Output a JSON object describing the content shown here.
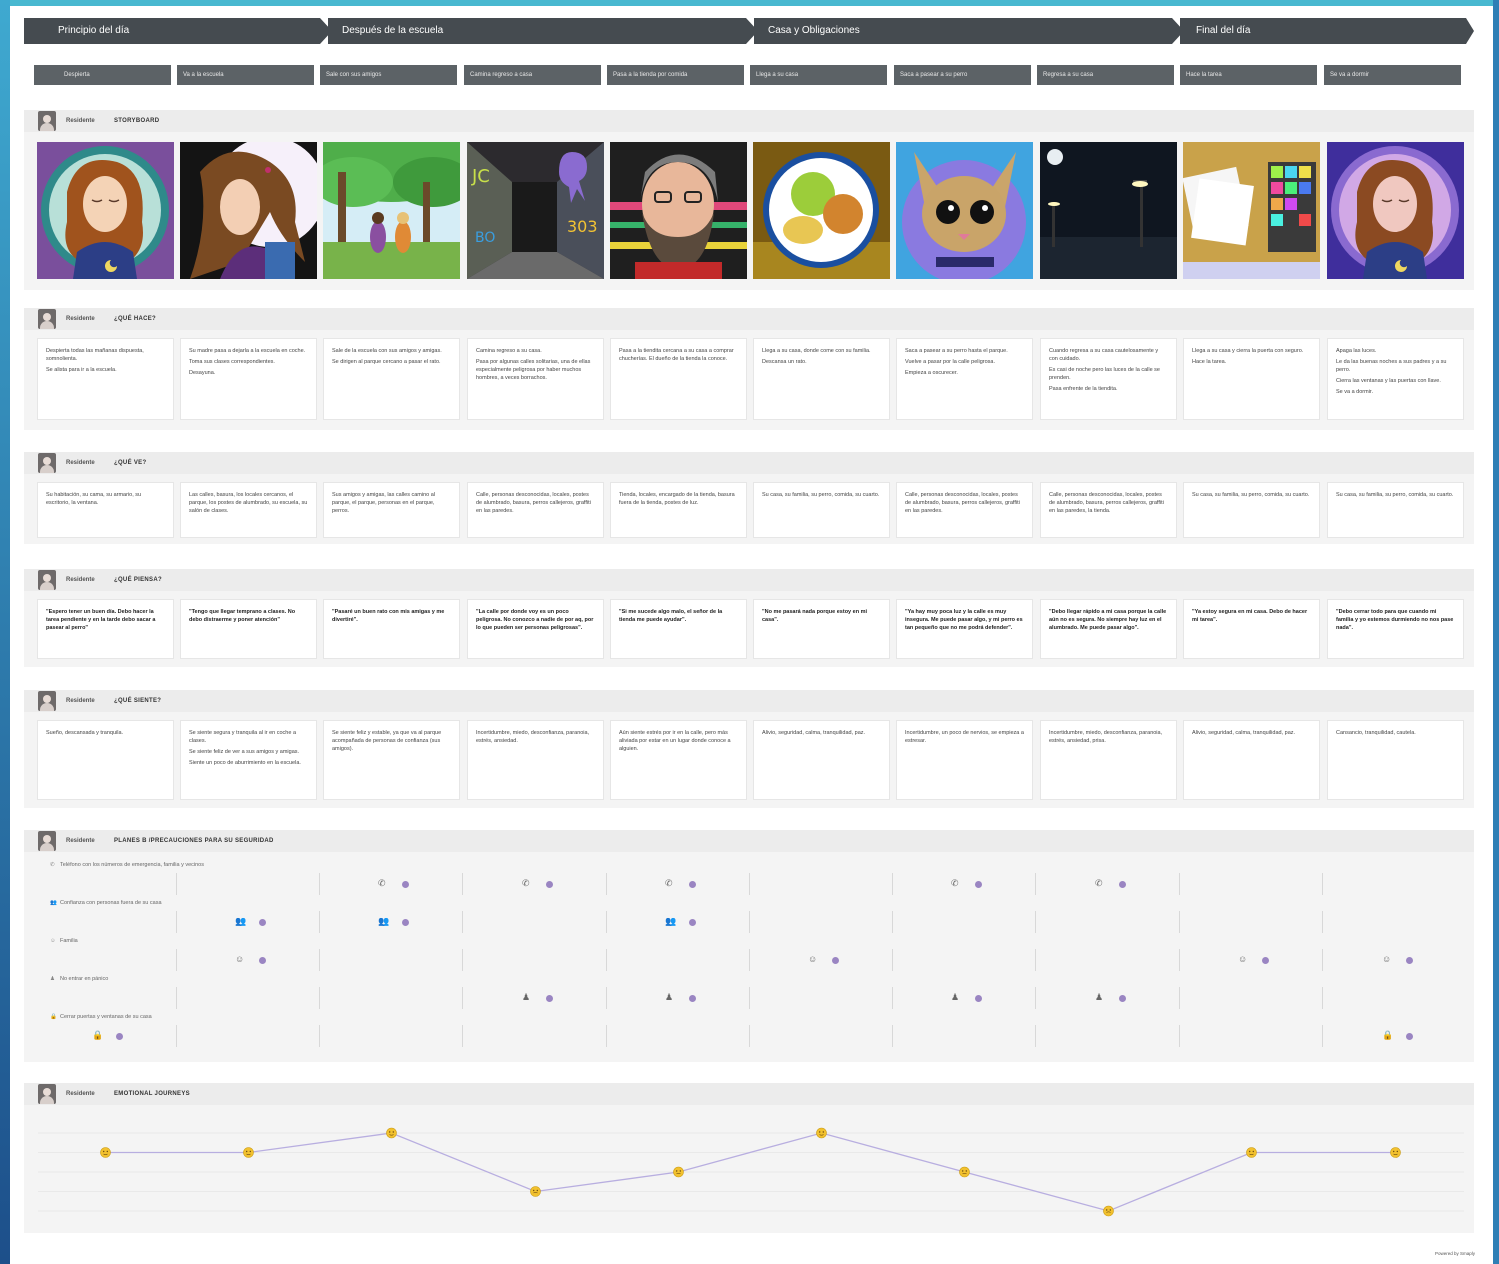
{
  "phases": [
    {
      "label": "Principio del día"
    },
    {
      "label": "Después de la escuela"
    },
    {
      "label": "Casa y Obligaciones"
    },
    {
      "label": "Final del día"
    }
  ],
  "steps": [
    "Despierta",
    "Va a la escuela",
    "Sale con sus amigos",
    "Camina regreso a casa",
    "Pasa a la tienda por comida",
    "Llega a su casa",
    "Saca a pasear a su perro",
    "Regresa a su casa",
    "Hace la tarea",
    "Se va a dormir"
  ],
  "persona": "Residente",
  "sections": {
    "storyboard": "STORYBOARD",
    "hace": "¿QUÉ HACE?",
    "ve": "¿QUÉ VE?",
    "piensa": "¿QUÉ PIENSA?",
    "siente": "¿QUÉ SIENTE?",
    "planes": "PLANES B /PRECAUCIONES PARA SU SEGURIDAD",
    "journey": "EMOTIONAL JOURNEYS"
  },
  "storyboard_images": [
    "girl-sleeping-image",
    "girl-backpack-image",
    "friends-park-image",
    "graffiti-alley-image",
    "shopkeeper-image",
    "dinner-plate-image",
    "dog-image",
    "night-street-image",
    "homework-board-image",
    "girl-sleeping-image"
  ],
  "hace": [
    [
      "Despierta todas las mañanas dispuesta, somnolienta.",
      "Se alista para ir a la escuela."
    ],
    [
      "Su madre pasa a dejarla a la escuela en coche.",
      "Toma sus clases correspondientes.",
      "Desayuna."
    ],
    [
      "Sale de la escuela con sus amigos y amigas.",
      "Se dirigen al parque cercano a pasar el rato."
    ],
    [
      "Camina regreso a su casa.",
      "Pasa por algunas calles solitarias, una de ellas especialmente peligrosa por haber muchos hombres, a veces borrachos."
    ],
    [
      "Pasa a la tiendita cercana a su casa a comprar chucherías. El dueño de la tienda la conoce."
    ],
    [
      "Llega a su casa, donde come con su familia.",
      "Descansa un rato."
    ],
    [
      "Saca a pasear a su perro hasta el parque.",
      "Vuelve a pasar por la calle peligrosa.",
      "Empieza a oscurecer."
    ],
    [
      "Cuando regresa a su casa cautelosamente y con cuidado.",
      "Es casi de noche pero las luces de la calle se prenden.",
      "Pasa enfrente de la tiendita."
    ],
    [
      "Llega a su casa y cierra la puerta con seguro.",
      "Hace la tarea."
    ],
    [
      "Apaga las luces.",
      "Le da las buenas noches a sus padres y a su perro.",
      "Cierra las ventanas y las puertas con llave.",
      "Se va a dormir."
    ]
  ],
  "ve": [
    "Su habitación, su cama, su armario, su escritorio, la ventana.",
    "Las calles, basura, los locales cercanos, el parque, los postes de alumbrado, su escuela, su salón de clases.",
    "Sus amigos y amigas, las calles camino al parque, el parque, personas en el parque, perros.",
    "Calle, personas desconocidas, locales, postes de alumbrado, basura, perros callejeros, graffiti en las paredes.",
    "Tienda, locales, encargado de la tienda, basura fuera de la tienda, postes de luz.",
    "Su casa, su familia, su perro, comida, su cuarto.",
    "Calle, personas desconocidas, locales, postes de alumbrado, basura, perros callejeros, graffiti en las paredes.",
    "Calle, personas desconocidas, locales, postes de alumbrado, basura, perros callejeros, graffiti en las paredes, la tienda.",
    "Su casa, su familia, su perro, comida, su cuarto.",
    "Su casa, su familia, su perro, comida, su cuarto."
  ],
  "piensa": [
    "\"Espero tener un buen día. Debo hacer la tarea pendiente y en la tarde debo sacar a pasear al perro\"",
    "\"Tengo que llegar temprano a clases. No debo distraerme y poner atención\"",
    "\"Pasaré un buen rato con mis amigas y me divertiré\".",
    "\"La calle por donde voy es un poco peligrosa. No conozco a nadie de por aq, por lo que pueden ser personas peligrosas\".",
    "\"Si me sucede algo malo, el señor de la tienda me puede ayudar\".",
    "\"No me pasará nada porque estoy en mi casa\".",
    "\"Ya hay muy poca luz y la calle es muy insegura. Me puede pasar algo, y mi perro es tan pequeño que no me podrá defender\".",
    "\"Debo llegar rápido a mi casa porque la calle aún no es segura. No siempre hay luz en el alumbrado. Me puede pasar algo\".",
    "\"Ya estoy segura en mi casa. Debo de hacer mi tarea\".",
    "\"Debo cerrar todo para que cuando mi familia y yo estemos durmiendo no nos pase nada\"."
  ],
  "siente": [
    [
      "Sueño, descansada y tranquila."
    ],
    [
      "Se siente segura y tranquila al ir en coche a clases.",
      "Se siente feliz de ver a sus amigos y amigas.",
      "Siente un poco de aburrimiento en la escuela."
    ],
    [
      "Se siente feliz y estable, ya que va al parque acompañada de personas de confianza (sus amigos)."
    ],
    [
      "Incertidumbre, miedo, desconfianza, paranoia, estrés, ansiedad."
    ],
    [
      "Aún siente estrés por ir en la calle, pero más aliviada por estar en un lugar donde conoce a alguien."
    ],
    [
      "Alivio, seguridad, calma, tranquilidad, paz."
    ],
    [
      "Incertidumbre, un poco de nervios, se empieza a estresar."
    ],
    [
      "Incertidumbre, miedo, desconfianza, paranoia, estrés, ansiedad, prisa."
    ],
    [
      "Alivio, seguridad, calma, tranquilidad, paz."
    ],
    [
      "Cansancio, tranquilidad, cautela."
    ]
  ],
  "planes": [
    {
      "label": "Teléfono con los números de emergencia, familia y vecinos",
      "icon": "phone-icon",
      "glyph": "✆",
      "cols": [
        2,
        3,
        4,
        6,
        7
      ]
    },
    {
      "label": "Confianza con personas fuera de su casa",
      "icon": "people-icon",
      "glyph": "👥",
      "cols": [
        1,
        2,
        4
      ]
    },
    {
      "label": "Familia",
      "icon": "family-icon",
      "glyph": "☺",
      "cols": [
        1,
        5,
        8,
        9
      ]
    },
    {
      "label": "No entrar en pánico",
      "icon": "calm-person-icon",
      "glyph": "♟",
      "cols": [
        3,
        4,
        6,
        7
      ]
    },
    {
      "label": "Cerrar puertas y ventanas de su casa",
      "icon": "lock-icon",
      "glyph": "🔒",
      "cols": [
        0,
        9
      ]
    }
  ],
  "journey": {
    "y_ticks": [
      "",
      "",
      "",
      "",
      ""
    ],
    "levels": [
      3,
      3,
      4,
      1,
      2,
      4,
      2,
      0,
      3,
      3
    ],
    "level_max": 4
  },
  "footer": {
    "powered": "Powered by Smaply"
  },
  "colors": {
    "phase_bg": "#454b50",
    "dot": "#9a85c2",
    "line": "#b8aee0",
    "emoji": "#f2c12e"
  }
}
